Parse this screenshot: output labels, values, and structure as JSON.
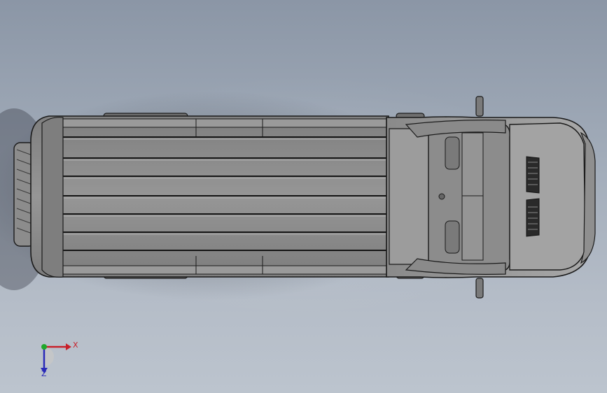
{
  "viewport": {
    "background_top": "#8b96a6",
    "background_bottom": "#bcc4ce",
    "model": {
      "name": "van-top-view",
      "body_color": "#8f8f8f",
      "edge_color": "#1a1a1a",
      "cab_color": "#9b9b9b"
    }
  },
  "triad": {
    "x_label": "X",
    "z_label": "Z",
    "x_color": "#c8202a",
    "y_color": "#1fa82a",
    "z_color": "#2a2ab8"
  }
}
